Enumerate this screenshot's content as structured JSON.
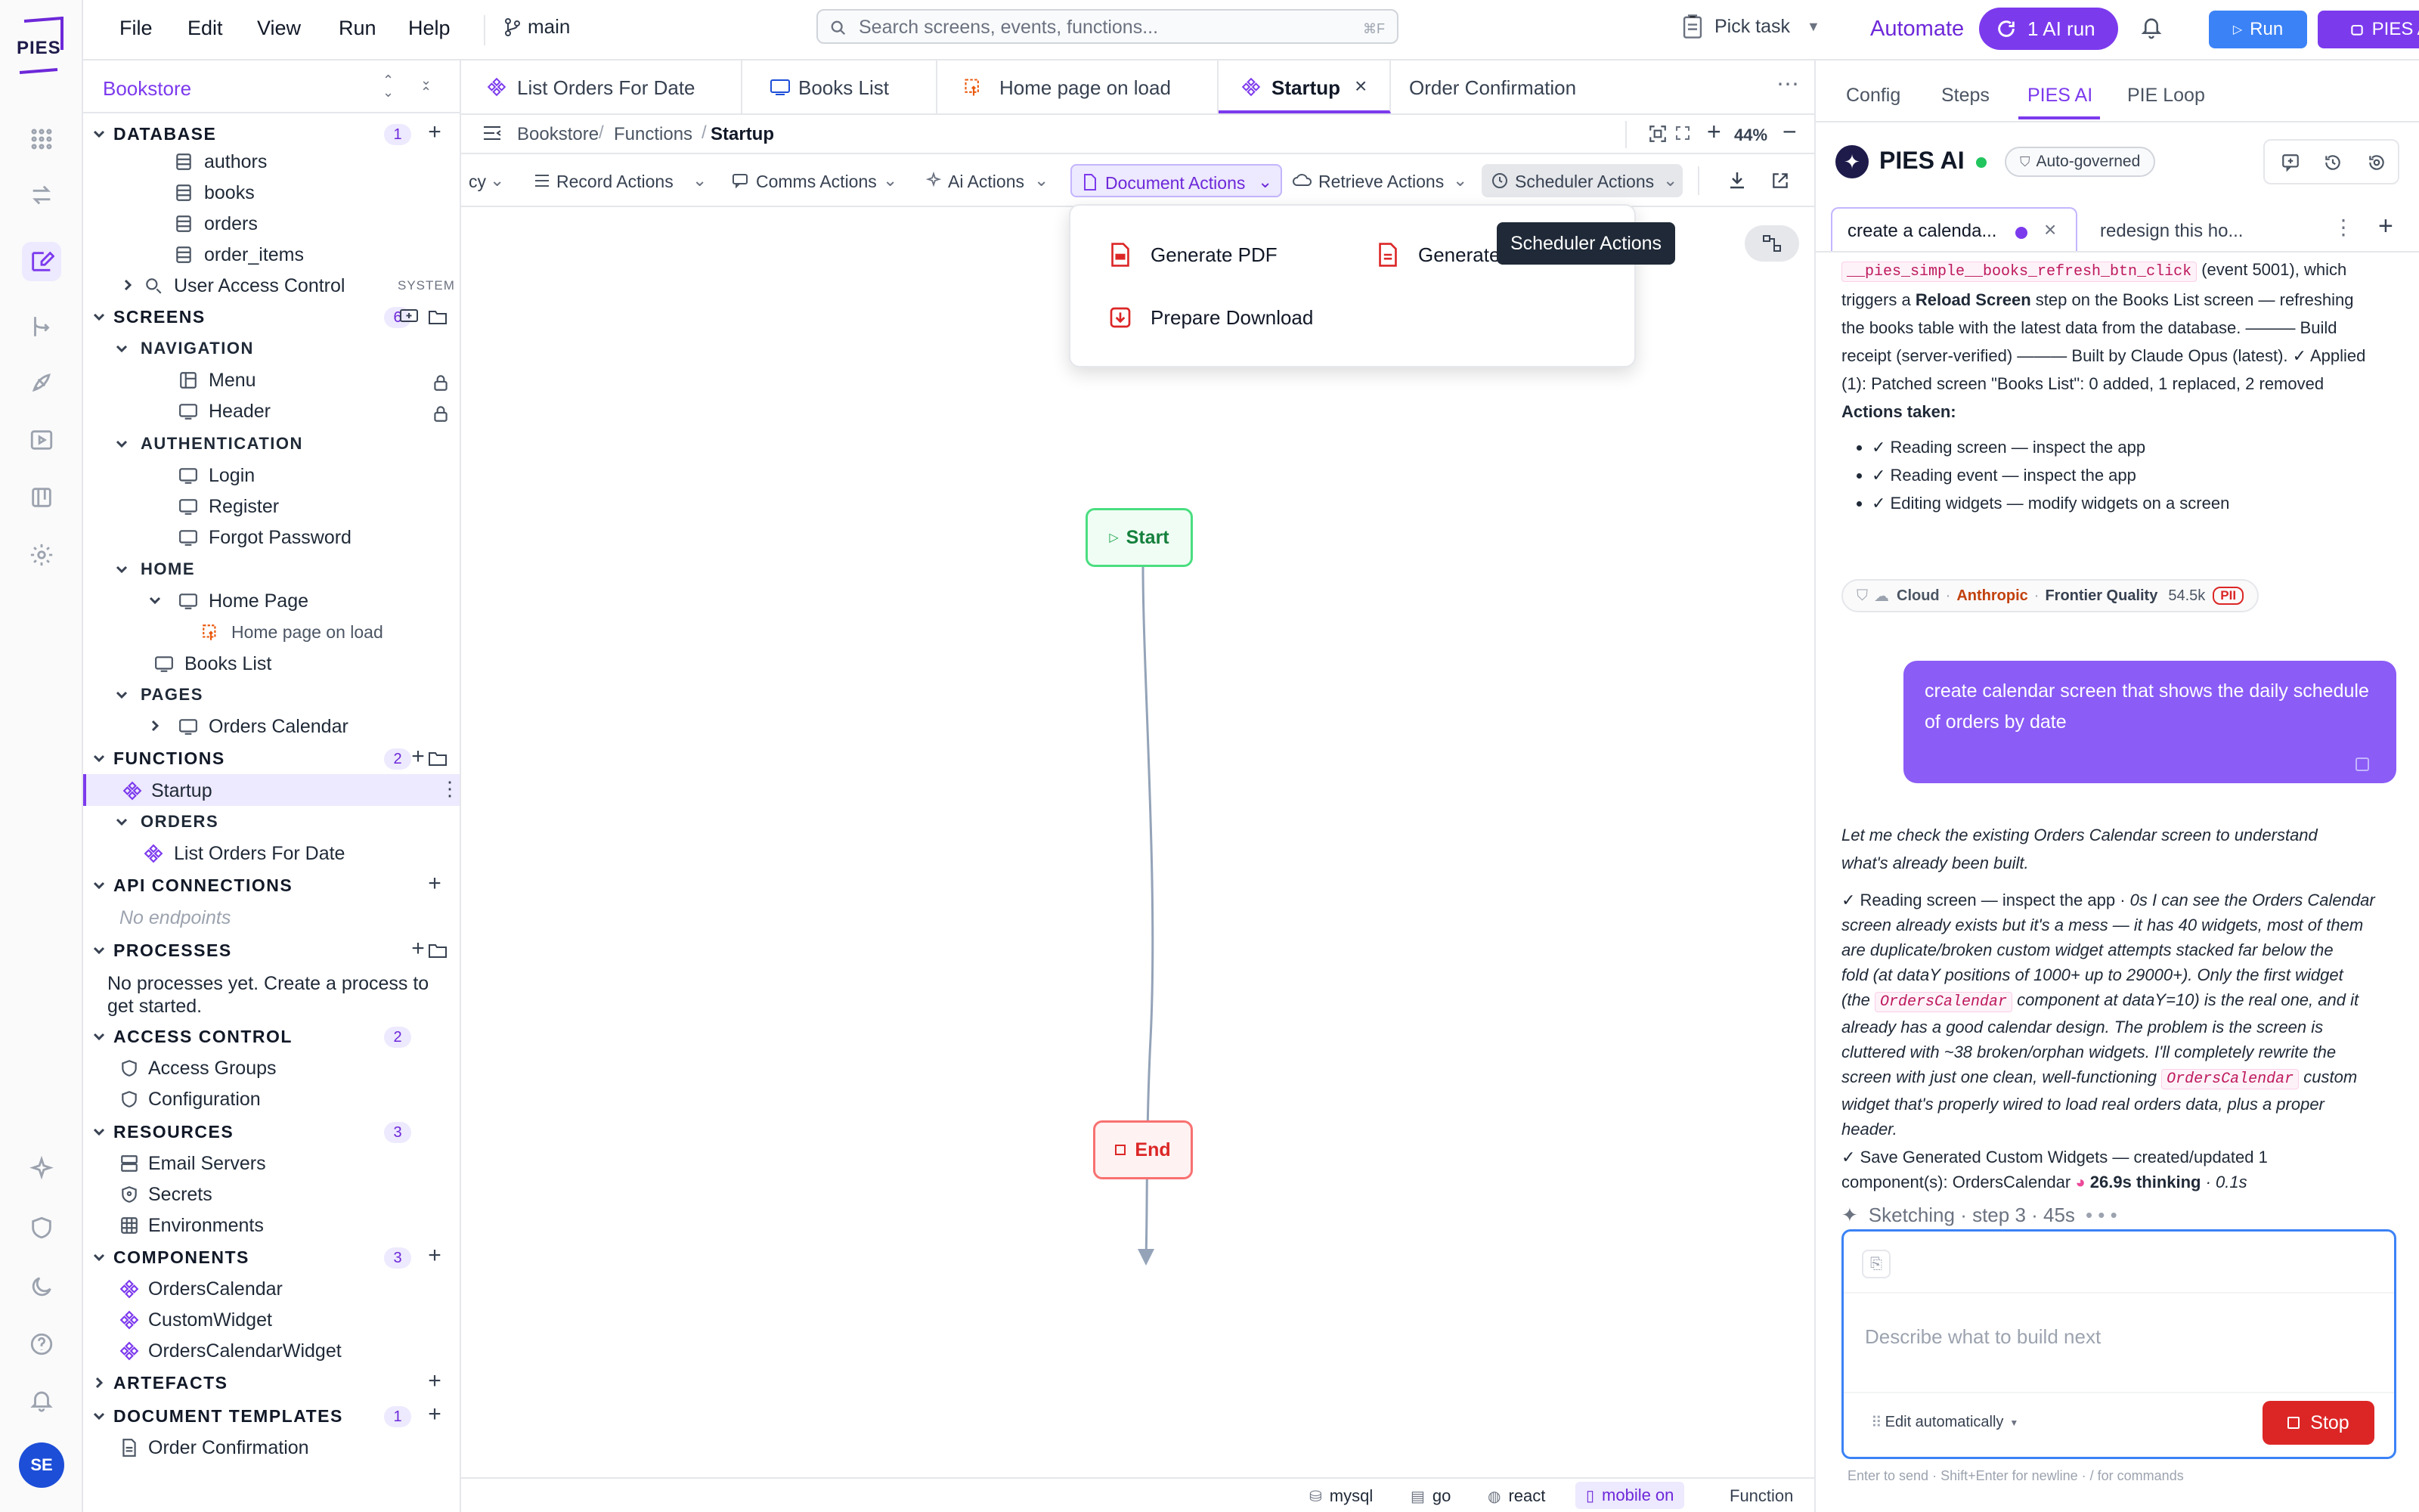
{
  "app": {
    "logo_text": "PIES",
    "user_initials": "SE"
  },
  "menu": [
    "File",
    "Edit",
    "View",
    "Run",
    "Help"
  ],
  "branch": "main",
  "search": {
    "placeholder": "Search screens, events, functions...",
    "shortcut": "⌘F"
  },
  "topbar": {
    "pick_task": "Pick task",
    "automate": "Automate",
    "ai_run": "1 AI run",
    "run": "Run",
    "pies_ai": "PIES AI"
  },
  "sidebar": {
    "project": "Bookstore",
    "database": {
      "label": "DATABASE",
      "count": "1",
      "tables": [
        "authors",
        "books",
        "orders",
        "order_items"
      ],
      "system_item": "User Access Control",
      "system_tag": "SYSTEM"
    },
    "screens": {
      "label": "SCREENS",
      "count": "6",
      "navigation": {
        "label": "NAVIGATION",
        "items": [
          "Menu",
          "Header"
        ]
      },
      "authentication": {
        "label": "AUTHENTICATION",
        "items": [
          "Login",
          "Register",
          "Forgot Password"
        ]
      },
      "home": {
        "label": "HOME",
        "page": "Home Page",
        "event": "Home page on load"
      },
      "books_list": "Books List",
      "pages": {
        "label": "PAGES",
        "items": [
          "Orders Calendar"
        ]
      }
    },
    "functions": {
      "label": "FUNCTIONS",
      "count": "2",
      "startup": "Startup",
      "orders_label": "ORDERS",
      "orders_item": "List Orders For Date"
    },
    "api": {
      "label": "API CONNECTIONS",
      "empty": "No endpoints"
    },
    "processes": {
      "label": "PROCESSES",
      "empty": "No processes yet. Create a process to get started."
    },
    "access": {
      "label": "ACCESS CONTROL",
      "count": "2",
      "items": [
        "Access Groups",
        "Configuration"
      ]
    },
    "resources": {
      "label": "RESOURCES",
      "count": "3",
      "items": [
        "Email Servers",
        "Secrets",
        "Environments"
      ]
    },
    "components": {
      "label": "COMPONENTS",
      "count": "3",
      "items": [
        "OrdersCalendar",
        "CustomWidget",
        "OrdersCalendarWidget"
      ]
    },
    "artefacts": {
      "label": "ARTEFACTS"
    },
    "doc_templates": {
      "label": "DOCUMENT TEMPLATES",
      "count": "1",
      "items": [
        "Order Confirmation"
      ]
    }
  },
  "tabs": [
    "List Orders For Date",
    "Books List",
    "Home page on load",
    "Startup",
    "Order Confirmation"
  ],
  "breadcrumb": [
    "Bookstore",
    "Functions",
    "Startup"
  ],
  "zoom": "44%",
  "actions": [
    "cy",
    "Record Actions",
    "Comms Actions",
    "Ai Actions",
    "Document Actions",
    "Retrieve Actions",
    "Scheduler Actions"
  ],
  "dropdown": {
    "items": [
      "Generate PDF",
      "Generate",
      "Prepare Download"
    ]
  },
  "tooltip": "Scheduler Actions",
  "flow": {
    "start": "Start",
    "end": "End"
  },
  "status": {
    "db": "mysql",
    "lang": "go",
    "ui": "react",
    "mobile": "mobile on",
    "kind": "Function"
  },
  "right_panel": {
    "tabs": [
      "Config",
      "Steps",
      "PIES AI",
      "PIE Loop"
    ],
    "title": "PIES AI",
    "governed": "Auto-governed",
    "chat_tabs": [
      "create a calenda...",
      "redesign this ho..."
    ],
    "msg1": {
      "code": "__pies_simple__books_refresh_btn_click",
      "t1": " (event 5001), which",
      "t2": "triggers a ",
      "t2b": "Reload Screen",
      "t3": " step on the Books List screen — refreshing",
      "line3": "the books table with the latest data from the database. ——— Build",
      "line4": "receipt (server-verified) ——— Built by Claude Opus (latest). ✓ Applied",
      "line5": "(1): Patched screen \"Books List\": 0 added, 1 replaced, 2 removed",
      "actions_title": "Actions taken:",
      "actions": [
        "✓ Reading screen — inspect the app",
        "✓ Reading event — inspect the app",
        "✓ Editing widgets — modify widgets on a screen"
      ],
      "chip": {
        "cloud": "Cloud",
        "provider": "Anthropic",
        "quality": "Frontier Quality",
        "tokens": "54.5k",
        "pii": "PII"
      }
    },
    "user_msg": "create calendar screen that shows the daily schedule of orders by date",
    "msg2": {
      "intro1": "Let me check the existing Orders Calendar screen to understand",
      "intro2": "what's already been built.",
      "l1a": "✓ Reading screen — inspect the app · ",
      "l1b": "0s I can see the Orders Calendar",
      "l2": "screen already exists but it's a mess — it has 40 widgets, most of them",
      "l3": "are duplicate/broken custom widget attempts stacked far below the",
      "l4": "fold (at dataY positions of 1000+ up to 29000+). Only the first widget",
      "l5a": "(the ",
      "l5code": "OrdersCalendar",
      "l5b": " component at dataY=10) is the real one, and it",
      "l6": "already has a good calendar design. The problem is the screen is",
      "l7": "cluttered with ~38 broken/orphan widgets. I'll completely rewrite the",
      "l8a": "screen with just one clean, well-functioning ",
      "l8code": "OrdersCalendar",
      "l8b": " custom",
      "l9": "widget that's properly wired to load real orders data, plus a proper",
      "l10": "header.",
      "s1": "✓ Save Generated Custom Widgets — created/updated 1",
      "s2a": "component(s): OrdersCalendar ",
      "s2b": "26.9s thinking",
      "s2c": " · 0.1s"
    },
    "progress": "Sketching · step 3 · 45s",
    "input_placeholder": "Describe what to build next",
    "edit_mode": "Edit automatically",
    "stop": "Stop",
    "hint": "Enter to send · Shift+Enter for newline · / for commands"
  },
  "colors": {
    "accent": "#7c3aed",
    "primary_blue": "#3b82f6",
    "start_green": "#16a34a",
    "end_red": "#dc2626",
    "stop_red": "#dc2626"
  }
}
